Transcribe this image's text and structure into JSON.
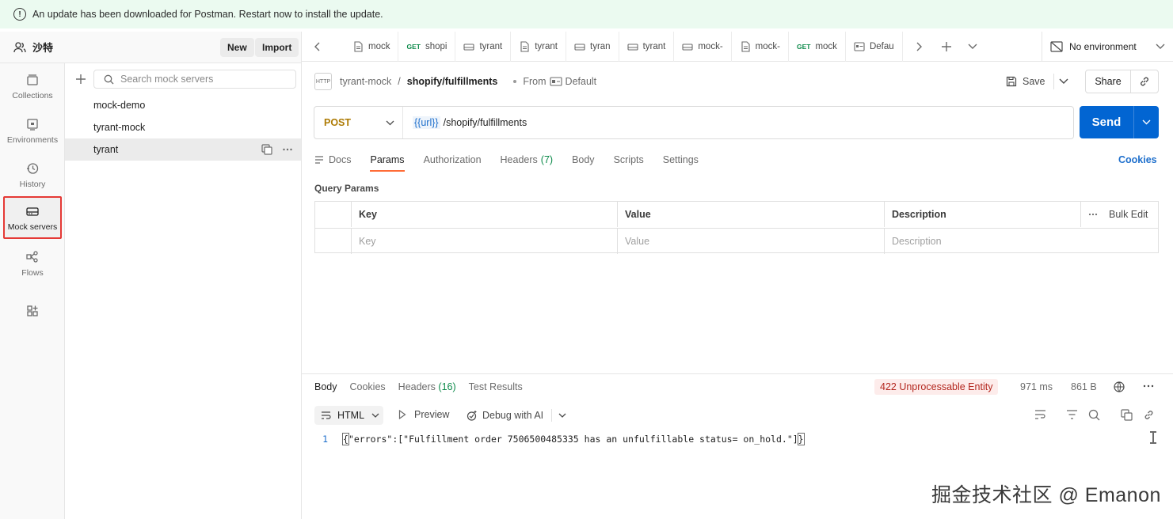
{
  "banner": {
    "text": "An update has been downloaded for Postman. Restart now to install the update.",
    "icon": "info-icon"
  },
  "workspace": {
    "name": "沙特",
    "new_label": "New",
    "import_label": "Import"
  },
  "rail": {
    "items": [
      {
        "label": "Collections",
        "icon": "collections-icon"
      },
      {
        "label": "Environments",
        "icon": "environments-icon"
      },
      {
        "label": "History",
        "icon": "history-icon"
      },
      {
        "label": "Mock servers",
        "icon": "mock-server-icon",
        "active": true
      },
      {
        "label": "Flows",
        "icon": "flows-icon"
      }
    ]
  },
  "mock_panel": {
    "search_placeholder": "Search mock servers",
    "items": [
      {
        "label": "mock-demo"
      },
      {
        "label": "tyrant-mock"
      },
      {
        "label": "tyrant",
        "selected": true
      }
    ]
  },
  "tabs": {
    "items": [
      {
        "label": "mock",
        "kind": "doc"
      },
      {
        "label": "shopi",
        "method": "GET"
      },
      {
        "label": "tyrant",
        "kind": "mock"
      },
      {
        "label": "tyrant",
        "kind": "doc"
      },
      {
        "label": "tyran",
        "kind": "mock"
      },
      {
        "label": "tyrant",
        "kind": "mock"
      },
      {
        "label": "mock-",
        "kind": "mock"
      },
      {
        "label": "mock-",
        "kind": "doc"
      },
      {
        "label": "mock",
        "method": "GET"
      },
      {
        "label": "Defau",
        "kind": "env"
      }
    ],
    "environment": "No environment"
  },
  "request": {
    "http_badge": "HTTP",
    "collection": "tyrant-mock",
    "name": "shopify/fulfillments",
    "from_label": "From",
    "from_env": "Default",
    "save_label": "Save",
    "share_label": "Share",
    "method": "POST",
    "url_var": "{{url}}",
    "url_path": "/shopify/fulfillments",
    "send_label": "Send",
    "tabs": [
      "Docs",
      "Params",
      "Authorization",
      "Headers",
      "Body",
      "Scripts",
      "Settings"
    ],
    "headers_count": "(7)",
    "cookies_label": "Cookies",
    "query_params_title": "Query Params",
    "columns": [
      "Key",
      "Value",
      "Description"
    ],
    "bulk_edit": "Bulk Edit",
    "placeholders": [
      "Key",
      "Value",
      "Description"
    ]
  },
  "response": {
    "tabs": [
      "Body",
      "Cookies",
      "Headers",
      "Test Results"
    ],
    "headers_count": "(16)",
    "status": "422 Unprocessable Entity",
    "status_color": "#b3261e",
    "time": "971 ms",
    "size": "861 B",
    "format": "HTML",
    "preview_label": "Preview",
    "debug_label": "Debug with AI",
    "line_number": "1",
    "body_open": "{",
    "body_text": "\"errors\":[\"Fulfillment order 7506500485335 has an unfulfillable status= on_hold.\"]",
    "body_close": "}"
  },
  "watermark": "掘金技术社区 @ Emanon",
  "colors": {
    "accent": "#ff6c37",
    "send": "#0265d2",
    "post": "#ad7a03",
    "get": "#0c8a4a",
    "link": "#1e6fcc"
  }
}
